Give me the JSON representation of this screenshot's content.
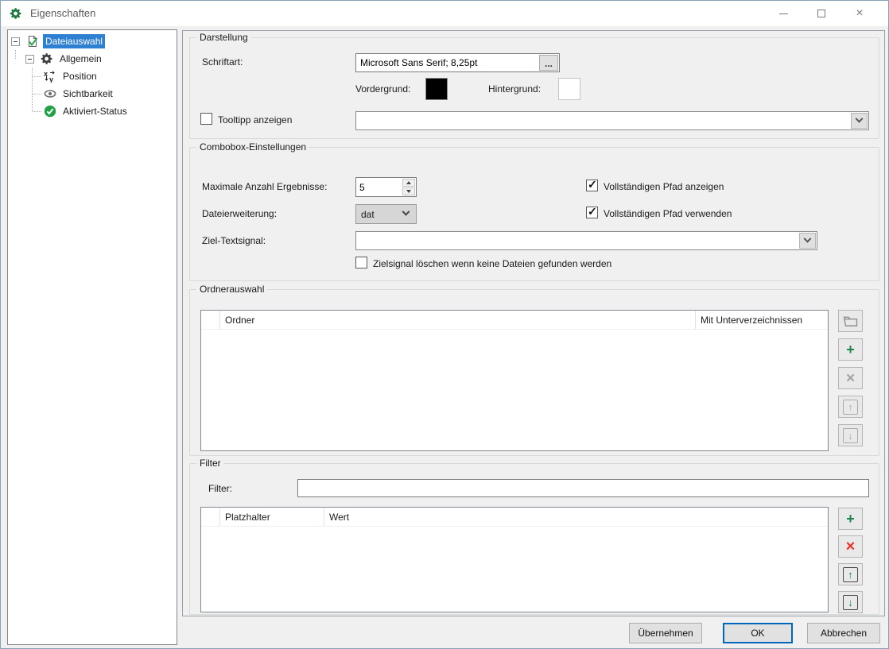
{
  "window": {
    "title": "Eigenschaften"
  },
  "titlebar": {
    "close_glyph": "×"
  },
  "tree": {
    "items": [
      {
        "label": "Dateiauswahl"
      },
      {
        "label": "Allgemein"
      },
      {
        "label": "Position"
      },
      {
        "label": "Sichtbarkeit"
      },
      {
        "label": "Aktiviert-Status"
      }
    ]
  },
  "darstellung": {
    "group_label": "Darstellung",
    "schriftart_label": "Schriftart:",
    "schriftart_value": "Microsoft Sans Serif; 8,25pt",
    "browse_button_label": "...",
    "vordergrund_label": "Vordergrund:",
    "vordergrund_color": "#000000",
    "hintergrund_label": "Hintergrund:",
    "hintergrund_color": "#ffffff",
    "tooltip_label": "Tooltipp anzeigen",
    "tooltip_check_glyph": "",
    "tooltip_combo_value": ""
  },
  "combobox": {
    "group_label": "Combobox-Einstellungen",
    "max_label": "Maximale Anzahl Ergebnisse:",
    "max_value": "5",
    "pfad_anzeigen_label": "Vollständigen Pfad anzeigen",
    "pfad_anzeigen_check_glyph": "✓",
    "erweiterung_label": "Dateierweiterung:",
    "erweiterung_value": "dat",
    "pfad_verwenden_label": "Vollständigen Pfad verwenden",
    "pfad_verwenden_check_glyph": "✓",
    "ziel_label": "Ziel-Textsignal:",
    "ziel_value": "",
    "loeschen_label": "Zielsignal löschen wenn keine Dateien gefunden werden",
    "loeschen_check_glyph": ""
  },
  "ordnerauswahl": {
    "group_label": "Ordnerauswahl",
    "col_ordner": "Ordner",
    "col_unterverzeichnisse": "Mit Unterverzeichnissen",
    "rows": [],
    "add_glyph": "+",
    "remove_glyph": "×",
    "up_glyph": "↑",
    "down_glyph": "↓"
  },
  "filter": {
    "group_label": "Filter",
    "filter_label": "Filter:",
    "filter_value": "",
    "col_platzhalter": "Platzhalter",
    "col_wert": "Wert",
    "rows": [],
    "add_glyph": "+",
    "remove_glyph": "×",
    "up_glyph": "↑",
    "down_glyph": "↓"
  },
  "footer": {
    "apply_label": "Übernehmen",
    "ok_label": "OK",
    "cancel_label": "Abbrechen"
  },
  "colors": {
    "selection_blue": "#2e80d2",
    "ok_border_blue": "#0067c0",
    "accent_green": "#1e8449",
    "accent_red": "#e8352a",
    "titlebar_icon_green": "#1d7a3f"
  }
}
